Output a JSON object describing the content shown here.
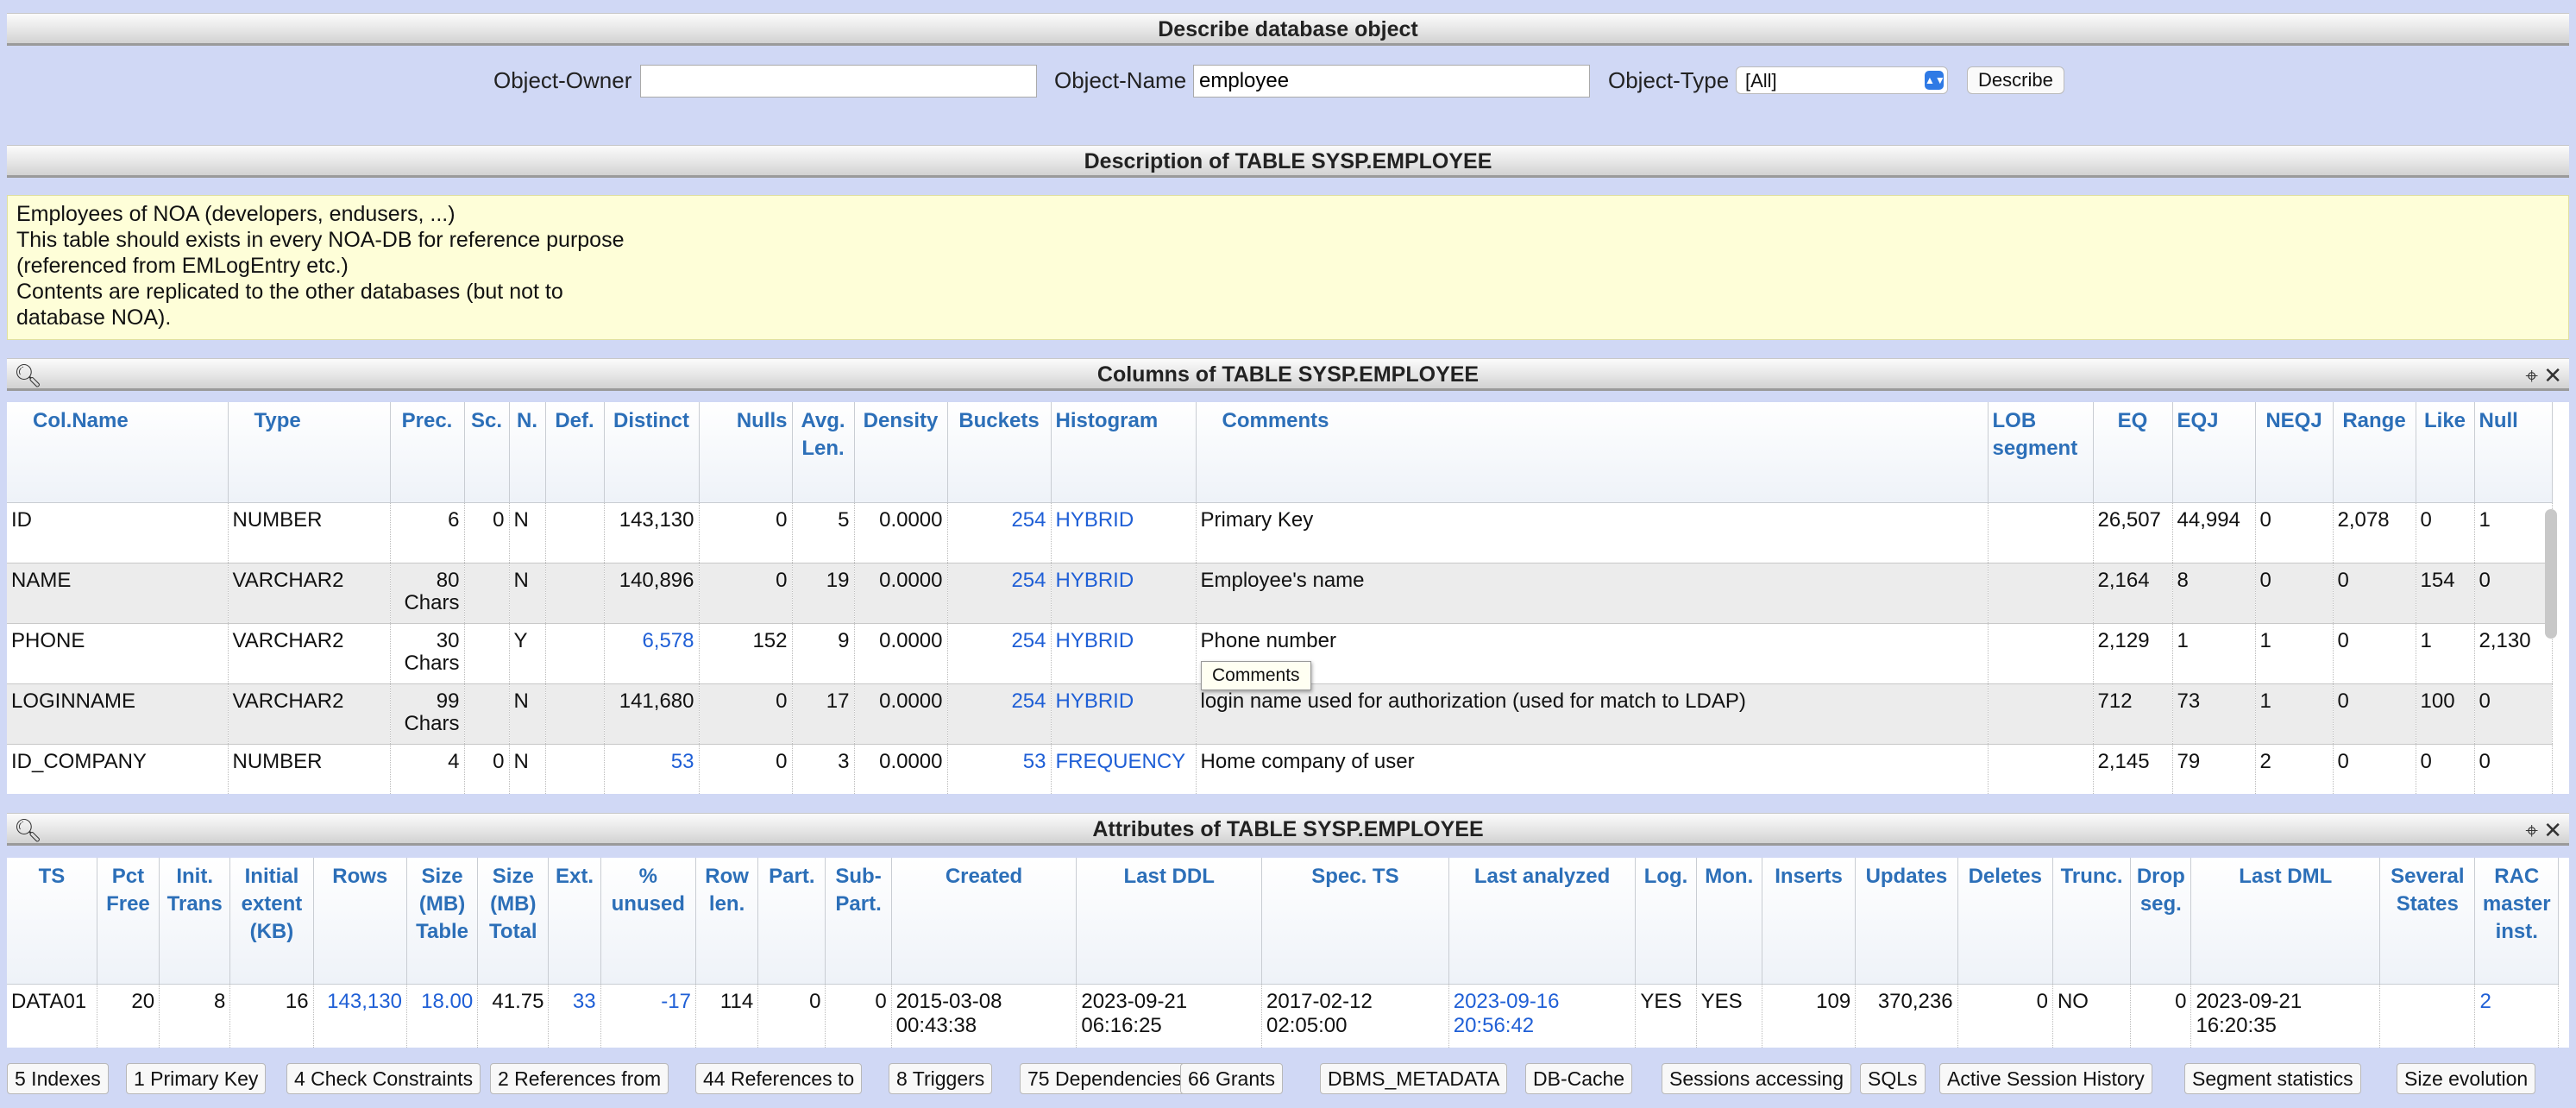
{
  "header": {
    "title": "Describe database object"
  },
  "form": {
    "owner_label": "Object-Owner",
    "owner_value": "",
    "name_label": "Object-Name",
    "name_value": "employee",
    "type_label": "Object-Type",
    "type_value": "[All]",
    "describe_button": "Describe"
  },
  "description": {
    "title": "Description of TABLE SYSP.EMPLOYEE",
    "lines": [
      "Employees of NOA (developers, endusers, ...)",
      "This table should exists in every NOA-DB for reference purpose",
      "(referenced from EMLogEntry etc.)",
      "Contents are replicated to the other databases (but not to",
      "database NOA)."
    ]
  },
  "columns_panel": {
    "title": "Columns of TABLE SYSP.EMPLOYEE",
    "headers": [
      "Col.Name",
      "Type",
      "Prec.",
      "Sc.",
      "N.",
      "Def.",
      "Distinct",
      "Nulls",
      "Avg. Len.",
      "Density",
      "Buckets",
      "Histogram",
      "Comments",
      "LOB segment",
      "EQ",
      "EQJ",
      "NEQJ",
      "Range",
      "Like",
      "Null"
    ],
    "rows": [
      {
        "name": "ID",
        "type": "NUMBER",
        "prec": "6",
        "prec2": "",
        "sc": "0",
        "n": "N",
        "def": "",
        "distinct": "143,130",
        "nulls": "0",
        "avglen": "5",
        "density": "0.0000",
        "buckets": "254",
        "histogram": "HYBRID",
        "comments": "Primary Key",
        "lob": "",
        "eq": "26,507",
        "eqj": "44,994",
        "neqj": "0",
        "range": "2,078",
        "like": "0",
        "null": "1"
      },
      {
        "name": "NAME",
        "type": "VARCHAR2",
        "prec": "80",
        "prec2": "Chars",
        "sc": "",
        "n": "N",
        "def": "",
        "distinct": "140,896",
        "nulls": "0",
        "avglen": "19",
        "density": "0.0000",
        "buckets": "254",
        "histogram": "HYBRID",
        "comments": "Employee's name",
        "lob": "",
        "eq": "2,164",
        "eqj": "8",
        "neqj": "0",
        "range": "0",
        "like": "154",
        "null": "0"
      },
      {
        "name": "PHONE",
        "type": "VARCHAR2",
        "prec": "30",
        "prec2": "Chars",
        "sc": "",
        "n": "Y",
        "def": "",
        "distinct": "6,578",
        "nulls": "152",
        "avglen": "9",
        "density": "0.0000",
        "buckets": "254",
        "histogram": "HYBRID",
        "comments": "Phone number",
        "lob": "",
        "eq": "2,129",
        "eqj": "1",
        "neqj": "1",
        "range": "0",
        "like": "1",
        "null": "2,130"
      },
      {
        "name": "LOGINNAME",
        "type": "VARCHAR2",
        "prec": "99",
        "prec2": "Chars",
        "sc": "",
        "n": "N",
        "def": "",
        "distinct": "141,680",
        "nulls": "0",
        "avglen": "17",
        "density": "0.0000",
        "buckets": "254",
        "histogram": "HYBRID",
        "comments": "login name used for authorization (used for match to LDAP)",
        "lob": "",
        "eq": "712",
        "eqj": "73",
        "neqj": "1",
        "range": "0",
        "like": "100",
        "null": "0"
      },
      {
        "name": "ID_COMPANY",
        "type": "NUMBER",
        "prec": "4",
        "prec2": "",
        "sc": "0",
        "n": "N",
        "def": "",
        "distinct": "53",
        "nulls": "0",
        "avglen": "3",
        "density": "0.0000",
        "buckets": "53",
        "histogram": "FREQUENCY",
        "comments": "Home company of user",
        "lob": "",
        "eq": "2,145",
        "eqj": "79",
        "neqj": "2",
        "range": "0",
        "like": "0",
        "null": "0"
      }
    ],
    "tooltip": "Comments"
  },
  "attributes_panel": {
    "title": "Attributes of TABLE SYSP.EMPLOYEE",
    "headers": [
      "TS",
      "Pct Free",
      "Init. Trans",
      "Initial extent (KB)",
      "Rows",
      "Size (MB) Table",
      "Size (MB) Total",
      "Ext.",
      "% unused",
      "Row len.",
      "Part.",
      "Sub-Part.",
      "Created",
      "Last DDL",
      "Spec. TS",
      "Last analyzed",
      "Log.",
      "Mon.",
      "Inserts",
      "Updates",
      "Deletes",
      "Trunc.",
      "Drop seg.",
      "Last DML",
      "Several States",
      "RAC master inst."
    ],
    "row": {
      "ts": "DATA01",
      "pctfree": "20",
      "inittrans": "8",
      "initext": "16",
      "rows": "143,130",
      "sizetable": "18.00",
      "sizetotal": "41.75",
      "ext": "33",
      "unused": "-17",
      "rowlen": "114",
      "part": "0",
      "subpart": "0",
      "created1": "2015-03-08",
      "created2": "00:43:38",
      "lastddl1": "2023-09-21",
      "lastddl2": "06:16:25",
      "spects1": "2017-02-12",
      "spects2": "02:05:00",
      "analyzed1": "2023-09-16",
      "analyzed2": "20:56:42",
      "log": "YES",
      "mon": "YES",
      "inserts": "109",
      "updates": "370,236",
      "deletes": "0",
      "trunc": "NO",
      "dropseg": "0",
      "lastdml1": "2023-09-21",
      "lastdml2": "16:20:35",
      "states": "",
      "rac": "2"
    }
  },
  "bottom_buttons": [
    "5 Indexes",
    "1 Primary Key",
    "4 Check Constraints",
    "2 References from",
    "44 References to",
    "8 Triggers",
    "75 Dependencies",
    "66 Grants",
    "DBMS_METADATA",
    "DB-Cache",
    "Sessions accessing",
    "SQLs",
    "Active Session History",
    "Segment statistics",
    "Size evolution"
  ],
  "icons": {
    "search": "magnifier-icon",
    "pin": "pin-icon",
    "close": "close-icon",
    "select_arrow": "chevron-updown-icon"
  }
}
